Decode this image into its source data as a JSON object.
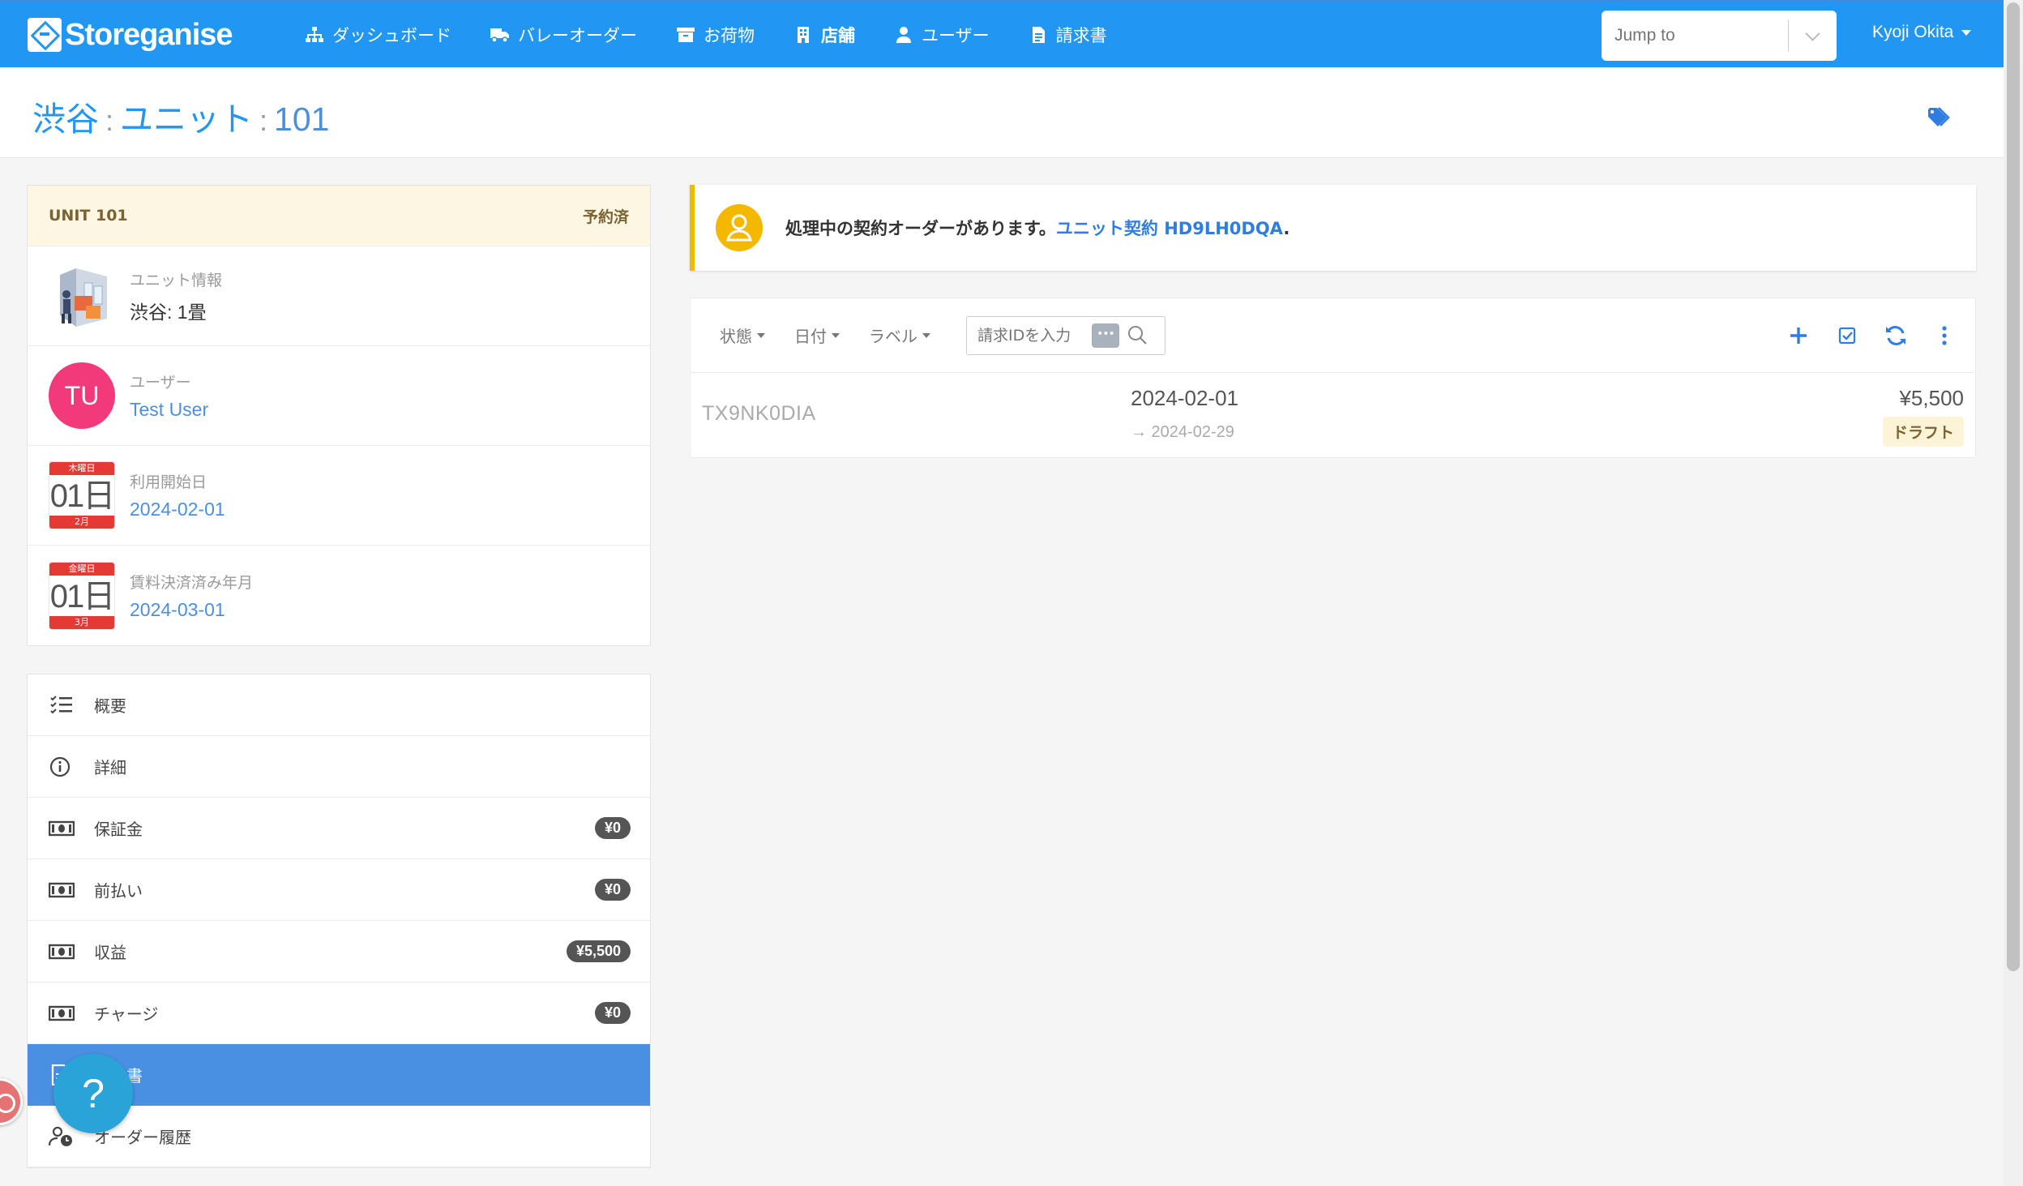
{
  "nav": {
    "brand": "Storeganise",
    "items": [
      {
        "label": "ダッシュボード",
        "icon": "sitemap-icon"
      },
      {
        "label": "バレーオーダー",
        "icon": "truck-icon"
      },
      {
        "label": "お荷物",
        "icon": "archive-icon"
      },
      {
        "label": "店舗",
        "icon": "building-icon"
      },
      {
        "label": "ユーザー",
        "icon": "user-icon"
      },
      {
        "label": "請求書",
        "icon": "invoice-icon"
      }
    ],
    "jump_placeholder": "Jump to",
    "user_name": "Kyoji Okita"
  },
  "page": {
    "breadcrumb_site": "渋谷",
    "breadcrumb_section": "ユニット",
    "breadcrumb_unit": "101",
    "separator": ":"
  },
  "unit": {
    "header_title": "UNIT 101",
    "header_status": "予約済",
    "info_label": "ユニット情報",
    "info_value": "渋谷: 1畳",
    "user_label": "ユーザー",
    "user_initials": "TU",
    "user_name": "Test User",
    "start_label": "利用開始日",
    "start_weekday": "木曜日",
    "start_day": "01日",
    "start_month": "2月",
    "start_date": "2024-02-01",
    "paid_label": "賃料決済済み年月",
    "paid_weekday": "金曜日",
    "paid_day": "01日",
    "paid_month": "3月",
    "paid_date": "2024-03-01"
  },
  "menu": [
    {
      "label": "概要",
      "icon": "checklist-icon",
      "badge": ""
    },
    {
      "label": "詳細",
      "icon": "info-icon",
      "badge": ""
    },
    {
      "label": "保証金",
      "icon": "money-icon",
      "badge": "¥0"
    },
    {
      "label": "前払い",
      "icon": "money-icon",
      "badge": "¥0"
    },
    {
      "label": "収益",
      "icon": "money-icon",
      "badge": "¥5,500"
    },
    {
      "label": "チャージ",
      "icon": "money-icon",
      "badge": "¥0"
    },
    {
      "label": "請求書",
      "icon": "invoice-icon",
      "badge": ""
    },
    {
      "label": "オーダー履歴",
      "icon": "user-clock-icon",
      "badge": ""
    }
  ],
  "alert": {
    "text": "処理中の契約オーダーがあります。",
    "link": "ユニット契約 HD9LH0DQA",
    "suffix": "."
  },
  "filters": {
    "status": "状態",
    "date": "日付",
    "label": "ラベル",
    "search_placeholder": "請求IDを入力"
  },
  "invoice": {
    "id": "TX9NK0DIA",
    "date": "2024-02-01",
    "due": "→ 2024-02-29",
    "amount": "¥5,500",
    "status": "ドラフト"
  },
  "help": {
    "label": "?"
  },
  "colors": {
    "primary": "#2196f3",
    "active": "#4a90e2",
    "warning": "#f5b800",
    "avatar": "#f23a7a",
    "calendar": "#e53935"
  }
}
